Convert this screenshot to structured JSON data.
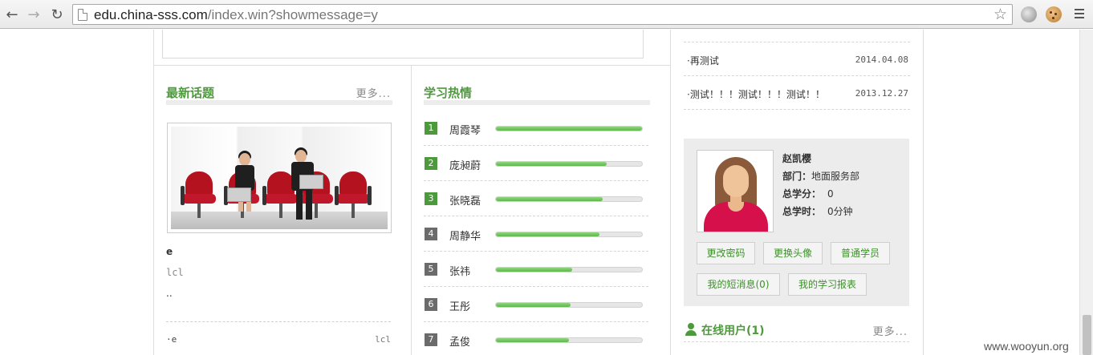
{
  "browser": {
    "url_host": "edu.china-sss.com",
    "url_path": "/index.win?showmessage=y"
  },
  "latest_topics": {
    "title": "最新话题",
    "more": "更多...",
    "featured": {
      "title": "e",
      "author": "lcl",
      "excerpt": ".."
    },
    "items": [
      {
        "title": "·e",
        "author": "lcl"
      }
    ]
  },
  "learning": {
    "title": "学习热情",
    "ranks": [
      {
        "num": "1",
        "name": "周霞琴",
        "progress": 1.0,
        "color": "#4d9a3c"
      },
      {
        "num": "2",
        "name": "庞昶蔚",
        "progress": 0.76,
        "color": "#4d9a3c"
      },
      {
        "num": "3",
        "name": "张晓磊",
        "progress": 0.73,
        "color": "#4d9a3c"
      },
      {
        "num": "4",
        "name": "周静华",
        "progress": 0.71,
        "color": "#6b6b6b"
      },
      {
        "num": "5",
        "name": "张祎",
        "progress": 0.52,
        "color": "#6b6b6b"
      },
      {
        "num": "6",
        "name": "王彤",
        "progress": 0.51,
        "color": "#6b6b6b"
      },
      {
        "num": "7",
        "name": "孟俊",
        "progress": 0.5,
        "color": "#6b6b6b"
      }
    ]
  },
  "notices": [
    {
      "title": "·再测试",
      "date": "2014.04.08"
    },
    {
      "title": "·测试！！！测试！！！测试！！",
      "date": "2013.12.27"
    }
  ],
  "user": {
    "name": "赵凯樱",
    "dept_label": "部门：",
    "dept_value": "地面服务部",
    "credits_label": "总学分：",
    "credits_value": "0",
    "hours_label": "总学时：",
    "hours_value": "0分钟",
    "buttons": {
      "change_password": "更改密码",
      "change_avatar": "更换头像",
      "role": "普通学员",
      "messages": "我的短消息(0)",
      "report": "我的学习报表"
    }
  },
  "online": {
    "title": "在线用户(1)",
    "more": "更多..."
  },
  "watermark": "www.wooyun.org",
  "colors": {
    "accent_green": "#4d9a3c",
    "rank_gray": "#6b6b6b"
  }
}
